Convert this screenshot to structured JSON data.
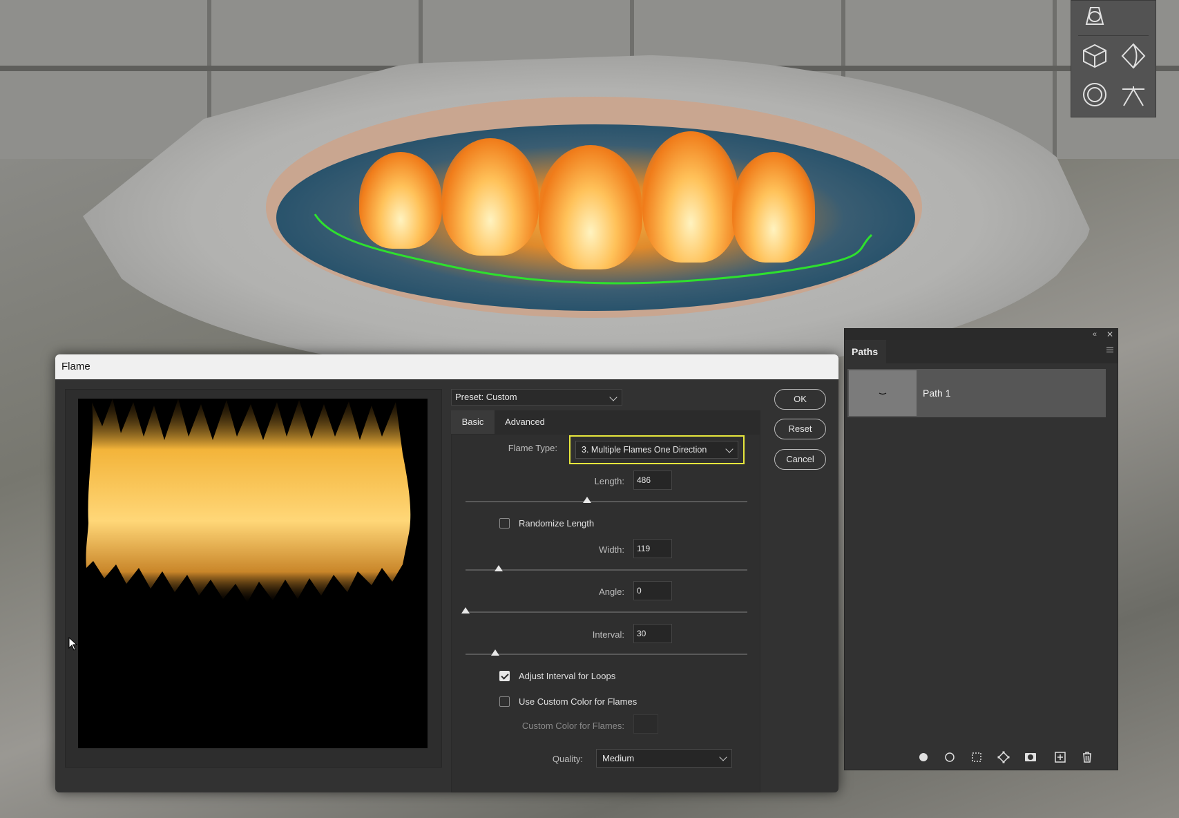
{
  "dialog": {
    "title": "Flame",
    "preset_label": "Preset: Custom",
    "tabs": [
      {
        "label": "Basic",
        "active": true
      },
      {
        "label": "Advanced",
        "active": false
      }
    ],
    "flame_type": {
      "label": "Flame Type:",
      "value": "3. Multiple Flames One Direction"
    },
    "length": {
      "label": "Length:",
      "value": "486"
    },
    "randomize_length": {
      "label": "Randomize Length",
      "checked": false
    },
    "width": {
      "label": "Width:",
      "value": "119"
    },
    "angle": {
      "label": "Angle:",
      "value": "0"
    },
    "interval": {
      "label": "Interval:",
      "value": "30"
    },
    "adjust_interval": {
      "label": "Adjust Interval for Loops",
      "checked": true
    },
    "use_custom_color": {
      "label": "Use Custom Color for Flames",
      "checked": false
    },
    "custom_color_label": "Custom Color for Flames:",
    "quality": {
      "label": "Quality:",
      "value": "Medium"
    },
    "buttons": {
      "ok": "OK",
      "reset": "Reset",
      "cancel": "Cancel"
    }
  },
  "paths_panel": {
    "tab_label": "Paths",
    "items": [
      {
        "name": "Path 1",
        "selected": true
      }
    ]
  },
  "colors": {
    "highlight": "#e7e73c",
    "path_stroke": "#2ee02e",
    "dialog_bg": "#323232"
  },
  "icons": {
    "tool_panel": [
      "perspective-icon",
      "cube-icon",
      "diamond-warp-icon",
      "sphere-icon",
      "umbrella-warp-icon"
    ],
    "paths_bottom": [
      "fill-path-icon",
      "stroke-path-icon",
      "load-selection-icon",
      "make-work-path-icon",
      "add-mask-icon",
      "new-path-icon",
      "delete-path-icon"
    ]
  }
}
